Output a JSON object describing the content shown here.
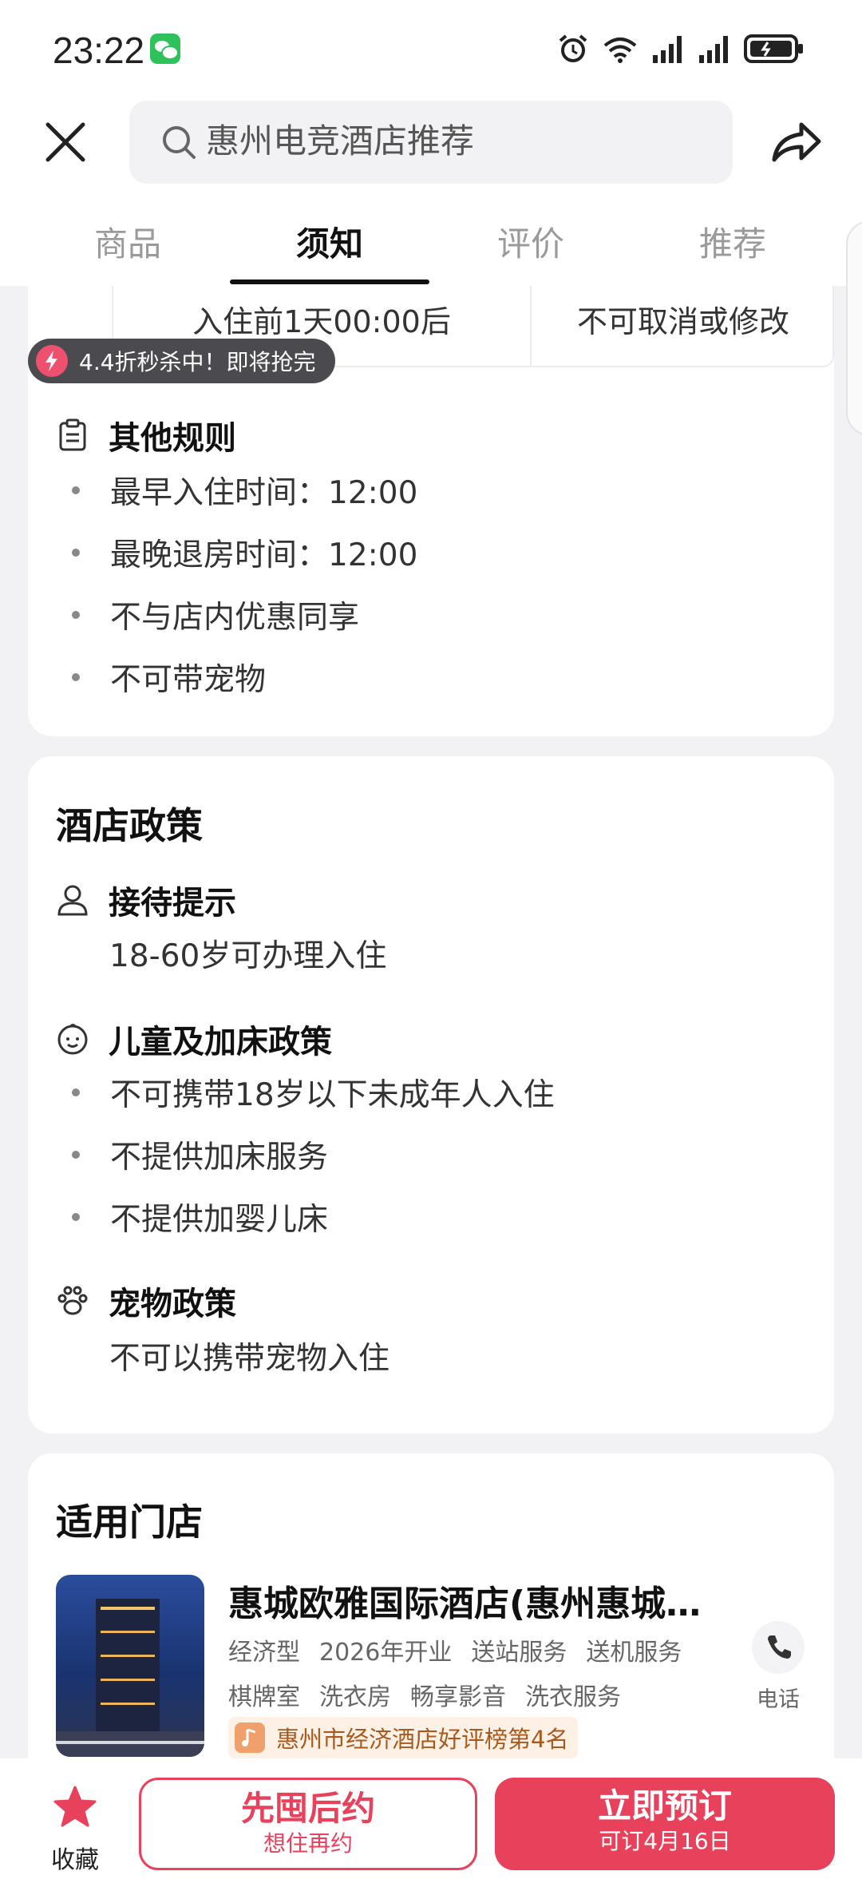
{
  "status_bar": {
    "time": "23:22"
  },
  "search": {
    "query": "惠州电竞酒店推荐"
  },
  "tabs": [
    {
      "label": "商品"
    },
    {
      "label": "须知"
    },
    {
      "label": "评价"
    },
    {
      "label": "推荐"
    }
  ],
  "cancel_policy": {
    "time_cell": "入住前1天00:00后",
    "rule_cell": "不可取消或修改"
  },
  "flash_sale": {
    "text": "4.4折秒杀中！即将抢完"
  },
  "other_rules": {
    "title": "其他规则",
    "items": [
      "最早入住时间：12:00",
      "最晚退房时间：12:00",
      "不与店内优惠同享",
      "不可带宠物"
    ]
  },
  "hotel_policy": {
    "title": "酒店政策",
    "reception": {
      "title": "接待提示",
      "text": "18-60岁可办理入住"
    },
    "children": {
      "title": "儿童及加床政策",
      "items": [
        "不可携带18岁以下未成年人入住",
        "不提供加床服务",
        "不提供加婴儿床"
      ]
    },
    "pets": {
      "title": "宠物政策",
      "text": "不可以携带宠物入住"
    }
  },
  "stores": {
    "title": "适用门店",
    "name": "惠城欧雅国际酒店(惠州惠城…",
    "tags_row1": [
      "经济型",
      "2026年开业",
      "送站服务",
      "送机服务"
    ],
    "tags_row2": [
      "棋牌室",
      "洗衣房",
      "畅享影音",
      "洗衣服务"
    ],
    "rank": "惠州市经济酒店好评榜第4名",
    "phone_label": "电话"
  },
  "bottom_bar": {
    "favorite_label": "收藏",
    "reserve_main": "先囤后约",
    "reserve_sub": "想住再约",
    "book_main": "立即预订",
    "book_sub": "可订4月16日"
  },
  "colors": {
    "accent": "#e8415b",
    "tab_active": "#111111"
  }
}
